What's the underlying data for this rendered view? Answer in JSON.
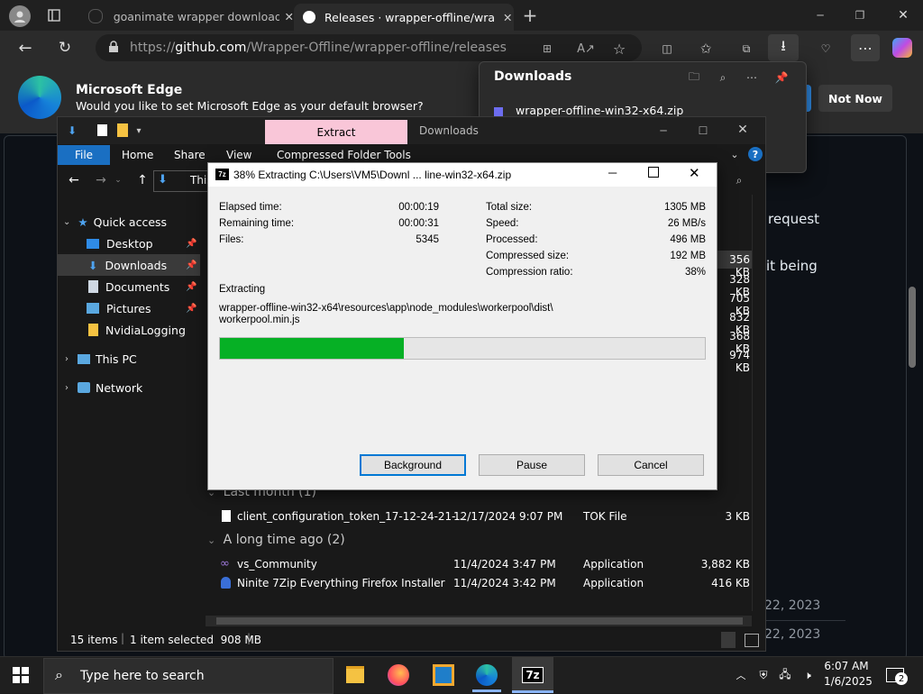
{
  "browser": {
    "tabs": [
      {
        "title": "goanimate wrapper download - S",
        "active": false
      },
      {
        "title": "Releases · wrapper-offline/wrapp",
        "active": true
      }
    ],
    "url_prefix": "https://",
    "url_host": "github.com",
    "url_path": "/Wrapper-Offline/wrapper-offline/releases"
  },
  "edge_banner": {
    "title": "Microsoft Edge",
    "message": "Would you like to set Microsoft Edge as your default browser?",
    "not_now": "Not Now"
  },
  "downloads_flyout": {
    "title": "Downloads",
    "file": "wrapper-offline-win32-x64.zip"
  },
  "webpage": {
    "text1": "request",
    "text2": "it being",
    "date1": "22, 2023",
    "date2": "22, 2023"
  },
  "explorer": {
    "tabs": {
      "extract": "Extract",
      "downloads": "Downloads"
    },
    "ribbon": [
      "File",
      "Home",
      "Share",
      "View",
      "Compressed Folder Tools"
    ],
    "address_partial": "This",
    "nav": {
      "quick_access": "Quick access",
      "desktop": "Desktop",
      "downloads": "Downloads",
      "documents": "Documents",
      "pictures": "Pictures",
      "nvidia": "NvidiaLogging",
      "this_pc": "This PC",
      "network": "Network"
    },
    "partial_sizes": [
      "356 KB",
      "328 KB",
      "705 KB",
      "832 KB",
      "368 KB",
      "974 KB"
    ],
    "groups": {
      "last_month": "Last month (1)",
      "long_ago": "A long time ago (2)"
    },
    "files": [
      {
        "name": "client_configuration_token_17-12-24-21-...",
        "date": "12/17/2024 9:07 PM",
        "type": "TOK File",
        "size": "3 KB"
      },
      {
        "name": "vs_Community",
        "date": "11/4/2024 3:47 PM",
        "type": "Application",
        "size": "3,882 KB"
      },
      {
        "name": "Ninite 7Zip Everything Firefox Installer",
        "date": "11/4/2024 3:42 PM",
        "type": "Application",
        "size": "416 KB"
      }
    ],
    "status": {
      "items": "15 items",
      "selected": "1 item selected  908 MB"
    }
  },
  "dialog": {
    "title": "38% Extracting C:\\Users\\VM5\\Downl ... line-win32-x64.zip",
    "elapsed_label": "Elapsed time:",
    "elapsed": "00:00:19",
    "remaining_label": "Remaining time:",
    "remaining": "00:00:31",
    "files_label": "Files:",
    "files": "5345",
    "total_label": "Total size:",
    "total": "1305 MB",
    "speed_label": "Speed:",
    "speed": "26 MB/s",
    "processed_label": "Processed:",
    "processed": "496 MB",
    "compressed_label": "Compressed size:",
    "compressed": "192 MB",
    "ratio_label": "Compression ratio:",
    "ratio": "38%",
    "extracting_label": "Extracting",
    "path1": "wrapper-offline-win32-x64\\resources\\app\\node_modules\\workerpool\\dist\\",
    "path2": "workerpool.min.js",
    "progress": 0.38,
    "buttons": {
      "background": "Background",
      "pause": "Pause",
      "cancel": "Cancel"
    }
  },
  "taskbar": {
    "search_placeholder": "Type here to search",
    "time": "6:07 AM",
    "date": "1/6/2025",
    "notifications": "2",
    "app_7z": "7z"
  },
  "colors": {
    "progress": "#06b025",
    "accent": "#0078d4",
    "extract_tab": "#f9c6d8"
  }
}
